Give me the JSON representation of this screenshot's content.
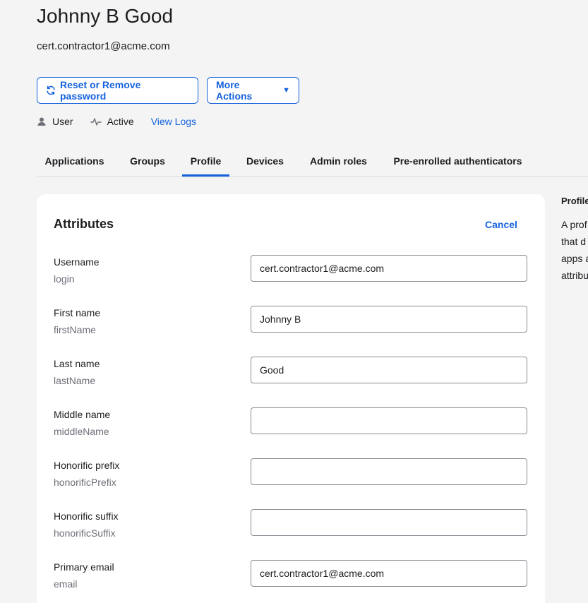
{
  "user": {
    "name": "Johnny B Good",
    "email": "cert.contractor1@acme.com"
  },
  "actions": {
    "reset_label": "Reset or Remove password",
    "more_label": "More Actions",
    "more_caret": "▼"
  },
  "status": {
    "type": "User",
    "state": "Active",
    "logs_link": "View Logs"
  },
  "tabs": [
    {
      "label": "Applications",
      "active": false
    },
    {
      "label": "Groups",
      "active": false
    },
    {
      "label": "Profile",
      "active": true
    },
    {
      "label": "Devices",
      "active": false
    },
    {
      "label": "Admin roles",
      "active": false
    },
    {
      "label": "Pre-enrolled authenticators",
      "active": false
    }
  ],
  "attributes": {
    "title": "Attributes",
    "cancel_label": "Cancel",
    "fields": [
      {
        "label": "Username",
        "key": "login",
        "value": "cert.contractor1@acme.com"
      },
      {
        "label": "First name",
        "key": "firstName",
        "value": "Johnny B"
      },
      {
        "label": "Last name",
        "key": "lastName",
        "value": "Good"
      },
      {
        "label": "Middle name",
        "key": "middleName",
        "value": ""
      },
      {
        "label": "Honorific prefix",
        "key": "honorificPrefix",
        "value": ""
      },
      {
        "label": "Honorific suffix",
        "key": "honorificSuffix",
        "value": ""
      },
      {
        "label": "Primary email",
        "key": "email",
        "value": "cert.contractor1@acme.com"
      }
    ]
  },
  "side_panel": {
    "title": "Profile",
    "lines": [
      "A prof",
      "that d",
      "apps a",
      "attribu"
    ]
  },
  "icons": {
    "reset": "refresh-icon",
    "user": "user-icon",
    "activity": "activity-icon"
  },
  "colors": {
    "accent": "#1662dd",
    "text": "#1d1d21",
    "muted": "#6e6e78",
    "background": "#f4f4f4"
  }
}
